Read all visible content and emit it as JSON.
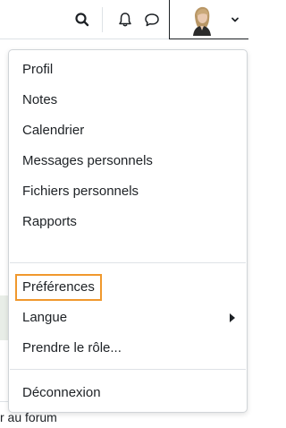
{
  "user_menu": {
    "items": [
      {
        "label": "Profil"
      },
      {
        "label": "Notes"
      },
      {
        "label": "Calendrier"
      },
      {
        "label": "Messages personnels"
      },
      {
        "label": "Fichiers personnels"
      },
      {
        "label": "Rapports"
      },
      {
        "label": "Préférences"
      },
      {
        "label": "Langue"
      },
      {
        "label": "Prendre le rôle..."
      },
      {
        "label": "Déconnexion"
      }
    ]
  },
  "background_page": {
    "link_text": "r au forum"
  },
  "colors": {
    "highlight_border": "#f0982d",
    "text": "#1d2125",
    "divider": "#dee2e6"
  },
  "icons": [
    "search-icon",
    "bell-icon",
    "chat-icon",
    "avatar",
    "chevron-down-icon",
    "chevron-right-icon"
  ]
}
